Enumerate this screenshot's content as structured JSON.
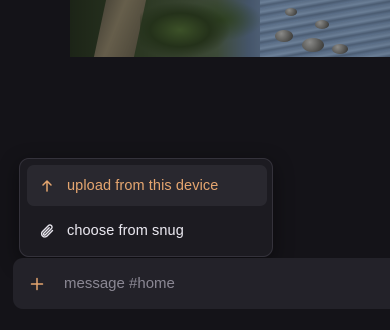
{
  "attachment_preview": {
    "kind": "image"
  },
  "attach_menu": {
    "items": [
      {
        "label": "upload from this device",
        "icon": "arrow-up-icon",
        "active": true
      },
      {
        "label": "choose from snug",
        "icon": "paperclip-icon",
        "active": false
      }
    ]
  },
  "composer": {
    "add_icon": "plus-icon",
    "placeholder": "message #home",
    "value": ""
  },
  "colors": {
    "background": "#141318",
    "accent": "#e4a56f",
    "menu_bg": "#1c1b21",
    "composer_bg": "#232229"
  }
}
